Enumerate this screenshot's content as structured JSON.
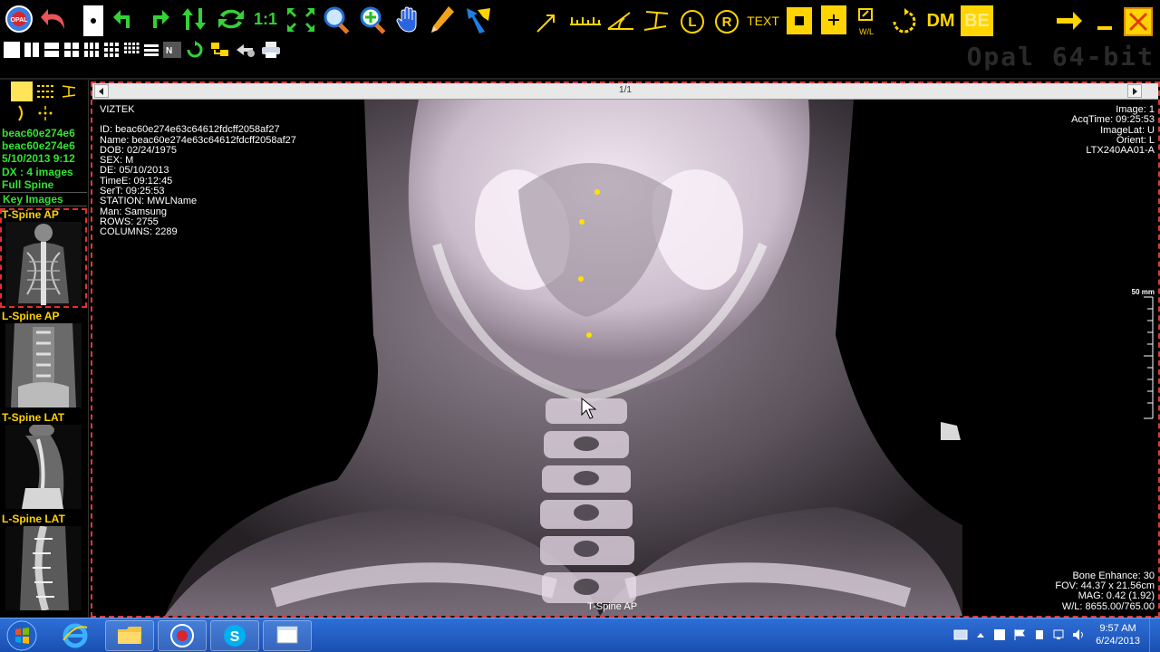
{
  "app": {
    "brand": "Opal 64-bit"
  },
  "toolbar": {
    "row1": [
      {
        "name": "opal-logo-icon"
      },
      {
        "name": "undo-arrow-icon"
      },
      {
        "name": "cursor-pointer-icon"
      },
      {
        "name": "rotate-left-icon"
      },
      {
        "name": "rotate-right-icon"
      },
      {
        "name": "flip-vertical-icon"
      },
      {
        "name": "flip-horizontal-icon"
      },
      {
        "name": "actual-size-icon",
        "label": "1:1"
      },
      {
        "name": "fit-to-window-icon"
      },
      {
        "name": "magnifier-icon"
      },
      {
        "name": "zoom-icon"
      },
      {
        "name": "pan-hand-icon"
      },
      {
        "name": "pencil-icon"
      },
      {
        "name": "map-pin-icon"
      }
    ],
    "measure_tools": [
      {
        "name": "arrow-tool-icon"
      },
      {
        "name": "ruler-tool-icon"
      },
      {
        "name": "angle-tool-icon"
      },
      {
        "name": "cobb-angle-icon"
      },
      {
        "name": "left-marker-icon",
        "label": "L"
      },
      {
        "name": "right-marker-icon",
        "label": "R"
      },
      {
        "name": "text-tool-icon",
        "label": "TEXT"
      },
      {
        "name": "roi-square-icon"
      },
      {
        "name": "add-annotation-icon"
      },
      {
        "name": "window-level-icon",
        "label": "W/L"
      },
      {
        "name": "reset-icon"
      },
      {
        "name": "dm-button",
        "label": "DM"
      },
      {
        "name": "be-button",
        "label": "BE"
      }
    ],
    "window": [
      {
        "name": "next-arrow-icon"
      },
      {
        "name": "minimize-icon"
      },
      {
        "name": "close-icon"
      }
    ]
  },
  "study": {
    "lines": [
      "beac60e274e6",
      "beac60e274e6",
      "5/10/2013 9:12",
      "DX : 4 images",
      "Full Spine"
    ],
    "key_images_label": "Key Images"
  },
  "thumbnails": [
    {
      "label": "T-Spine AP",
      "selected": true
    },
    {
      "label": "L-Spine AP",
      "selected": false
    },
    {
      "label": "T-Spine LAT",
      "selected": false
    },
    {
      "label": "L-Spine LAT",
      "selected": false
    }
  ],
  "viewer": {
    "page_indicator": "1/1",
    "top_left": [
      "VIZTEK",
      "",
      "ID: beac60e274e63c64612fdcff2058af27",
      "Name: beac60e274e63c64612fdcff2058af27",
      "DOB: 02/24/1975",
      "SEX: M",
      "DE: 05/10/2013",
      "TimeE: 09:12:45",
      "SerT: 09:25:53",
      "STATION: MWLName",
      "Man: Samsung",
      "ROWS: 2755",
      "COLUMNS: 2289"
    ],
    "top_right": [
      "Image: 1",
      "AcqTime: 09:25:53",
      "ImageLat: U",
      "Orient: L",
      "LTX240AA01-A"
    ],
    "bottom_right": [
      "Bone Enhance: 30",
      "FOV: 44.37 x 21.56cm",
      "MAG: 0.42 (1.92)",
      "W/L: 8655.00/765.00"
    ],
    "bottom_center": "T-Spine AP",
    "ruler_label": "50 mm"
  },
  "taskbar": {
    "apps": [
      {
        "name": "start-button"
      },
      {
        "name": "internet-explorer-icon"
      },
      {
        "name": "file-explorer-icon"
      },
      {
        "name": "opal-app-icon"
      },
      {
        "name": "skype-icon"
      },
      {
        "name": "folder-window-icon"
      }
    ],
    "clock": {
      "time": "9:57 AM",
      "date": "6/24/2013"
    }
  }
}
